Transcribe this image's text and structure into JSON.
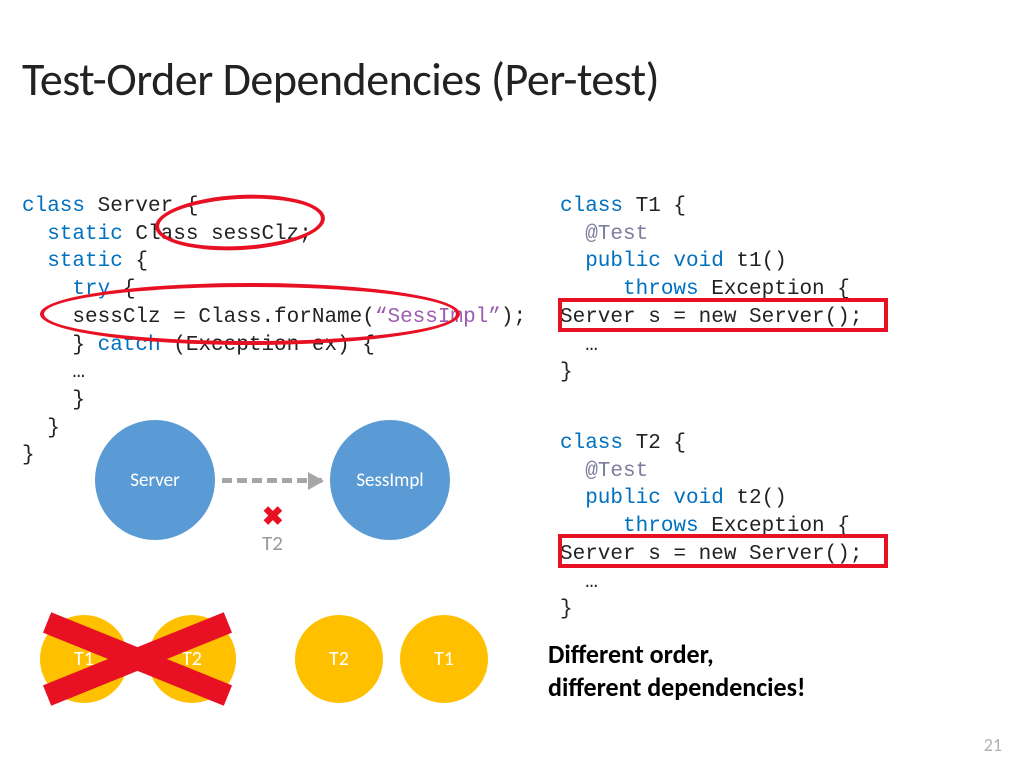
{
  "title": "Test-Order Dependencies (Per-test)",
  "code_left": {
    "l1a": "class",
    "l1b": " Server {",
    "l2a": "  static",
    "l2b": " Class sessClz;",
    "l3a": "  static",
    "l3b": " {",
    "l4a": "    try",
    "l4b": " {",
    "l5a": "    sessClz = Class.forName(",
    "l5s": "“SessImpl”",
    "l5b": ");",
    "l6a": "    } ",
    "l6b": "catch",
    "l6c": " (Exception ex) {",
    "l7": "    …",
    "l8": "    }",
    "l9": "  }",
    "l10": "}"
  },
  "code_t1": {
    "l1a": "class",
    "l1b": " T1 {",
    "l2": "  @Test",
    "l3a": "  public void",
    "l3b": " t1()",
    "l4a": "     throws",
    "l4b": " Exception {",
    "l5": "Server s = new Server();",
    "l6": "  …",
    "l7": "}"
  },
  "code_t2": {
    "l1a": "class",
    "l1b": " T2 {",
    "l2": "  @Test",
    "l3a": "  public void",
    "l3b": " t2()",
    "l4a": "     throws",
    "l4b": " Exception {",
    "l5": "Server s = new Server();",
    "l6": "  …",
    "l7": "}"
  },
  "diagram": {
    "node_server": "Server",
    "node_sess": "SessImpl",
    "x": "✖",
    "t2": "T2",
    "order1a": "T1",
    "order1b": "T2",
    "order2a": "T2",
    "order2b": "T1"
  },
  "summary_line1": "Different order,",
  "summary_line2": "different dependencies!",
  "page": "21"
}
